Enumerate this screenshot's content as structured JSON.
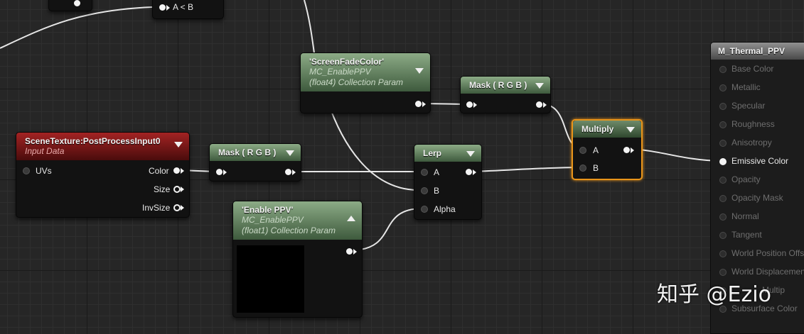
{
  "nodes": {
    "compare": {
      "pin_label": "A < B"
    },
    "screen_fade": {
      "title": "'ScreenFadeColor'",
      "sub1": "MC_EnablePPV",
      "sub2": "(float4) Collection Param"
    },
    "mask1": {
      "title": "Mask ( R G B )"
    },
    "mask2": {
      "title": "Mask ( R G B )"
    },
    "scene_texture": {
      "title": "SceneTexture:PostProcessInput0",
      "sub": "Input Data",
      "in_uvs": "UVs",
      "out_color": "Color",
      "out_size": "Size",
      "out_invsize": "InvSize"
    },
    "lerp": {
      "title": "Lerp",
      "in_a": "A",
      "in_b": "B",
      "in_alpha": "Alpha"
    },
    "enable_ppv": {
      "title": "'Enable PPV'",
      "sub1": "MC_EnablePPV",
      "sub2": "(float1) Collection Param"
    },
    "multiply": {
      "title": "Multiply",
      "in_a": "A",
      "in_b": "B"
    }
  },
  "result": {
    "title": "M_Thermal_PPV",
    "pins": [
      "Base Color",
      "Metallic",
      "Specular",
      "Roughness",
      "Anisotropy",
      "Emissive Color",
      "Opacity",
      "Opacity Mask",
      "Normal",
      "Tangent",
      "World Position Offs",
      "World Displacement",
      "Multip",
      "Subsurface Color"
    ],
    "active_pin": "Emissive Color"
  },
  "watermark": "知乎 @Ezio",
  "colors": {
    "selected_border": "#e8941a",
    "param_header": "#6e8e68",
    "scene_header": "#9a1f1f"
  }
}
